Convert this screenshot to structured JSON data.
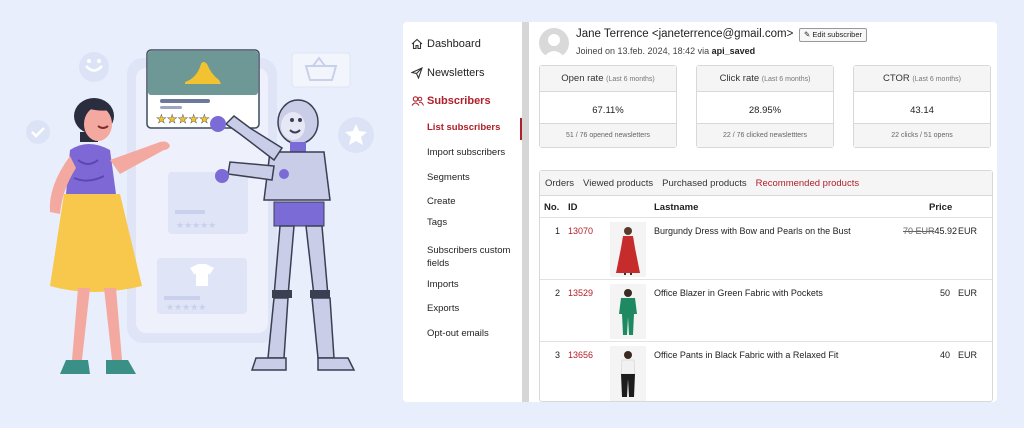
{
  "sidebar": {
    "items": [
      {
        "label": "Dashboard",
        "icon": "home-icon"
      },
      {
        "label": "Newsletters",
        "icon": "paper-plane-icon"
      },
      {
        "label": "Subscribers",
        "icon": "users-icon"
      }
    ],
    "sub_items": [
      "List subscribers",
      "Import subscribers",
      "Segments",
      "Create",
      "Tags",
      "Subscribers custom fields",
      "Imports",
      "Exports",
      "Opt-out emails"
    ]
  },
  "subscriber": {
    "name_line": "Jane Terrence <janeterrence@gmail.com>",
    "edit_label": "Edit subscriber",
    "joined_prefix": "Joined on 13.feb. 2024, 18:42 via ",
    "joined_source": "api_saved"
  },
  "stats": [
    {
      "title": "Open rate",
      "period": "(Last 6 months)",
      "value": "67.11%",
      "footer": "51 / 76 opened newsletters"
    },
    {
      "title": "Click rate",
      "period": "(Last 6 months)",
      "value": "28.95%",
      "footer": "22 / 76 clicked newslettters"
    },
    {
      "title": "CTOR",
      "period": "(Last 6 months)",
      "value": "43.14",
      "footer": "22 clicks / 51 opens"
    }
  ],
  "tabs": [
    "Orders",
    "Viewed products",
    "Purchased products",
    "Recommended products"
  ],
  "table": {
    "headers": {
      "no": "No.",
      "id": "ID",
      "lastname": "Lastname",
      "price": "Price"
    },
    "rows": [
      {
        "no": "1",
        "id": "13070",
        "name": "Burgundy Dress with Bow and Pearls on the Bust",
        "old_price": "70 EUR",
        "price": "45.92",
        "currency": "EUR"
      },
      {
        "no": "2",
        "id": "13529",
        "name": "Office Blazer in Green Fabric with Pockets",
        "old_price": "",
        "price": "50",
        "currency": "EUR"
      },
      {
        "no": "3",
        "id": "13656",
        "name": "Office Pants in Black Fabric with a Relaxed Fit",
        "old_price": "",
        "price": "40",
        "currency": "EUR"
      }
    ]
  },
  "colors": {
    "accent": "#b0202a",
    "background": "#e9eefc"
  }
}
